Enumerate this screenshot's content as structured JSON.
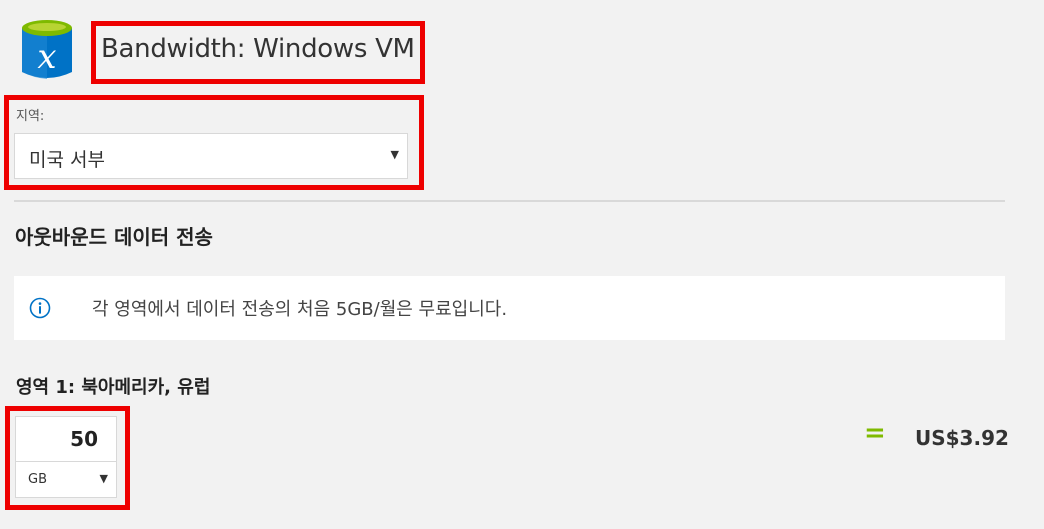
{
  "product": {
    "icon": "sql-database-icon",
    "title": "Bandwidth: Windows VM"
  },
  "region": {
    "label": "지역:",
    "selected": "미국 서부"
  },
  "section": {
    "heading": "아웃바운드 데이터 전송"
  },
  "info": {
    "icon": "info-icon",
    "text": "각 영역에서 데이터 전송의 처음 5GB/월은 무료입니다."
  },
  "zone": {
    "heading": "영역 1: 북아메리카, 유럽",
    "quantity": "50",
    "unit": "GB",
    "equals": "=",
    "price": "US$3.92"
  },
  "colors": {
    "highlight": "#ee0000",
    "accent_green": "#7fba00",
    "icon_blue": "#0072c6",
    "icon_cap_green": "#7fba00"
  }
}
